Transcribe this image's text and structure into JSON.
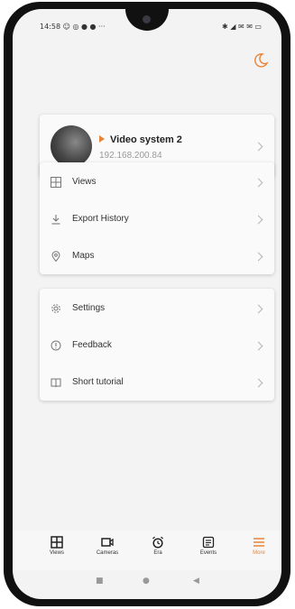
{
  "status_bar": {
    "time_and_icons": "14:58 ☺ ◎ ● ● ···",
    "right_icons": "✱ ◢ ✉ ✉ ▭"
  },
  "system": {
    "name": "Video system 2",
    "ip": "192.168.200.84"
  },
  "menu_group_1": [
    {
      "label": "Views",
      "icon": "grid-icon"
    },
    {
      "label": "Export History",
      "icon": "download-icon"
    },
    {
      "label": "Maps",
      "icon": "map-pin-icon"
    }
  ],
  "menu_group_2": [
    {
      "label": "Settings",
      "icon": "gear-icon"
    },
    {
      "label": "Feedback",
      "icon": "info-icon"
    },
    {
      "label": "Short tutorial",
      "icon": "book-icon"
    }
  ],
  "bottom_nav": [
    {
      "label": "Views",
      "icon": "views-icon",
      "active": false
    },
    {
      "label": "Cameras",
      "icon": "camera-icon",
      "active": false
    },
    {
      "label": "Era",
      "icon": "alarm-icon",
      "active": false
    },
    {
      "label": "Events",
      "icon": "events-icon",
      "active": false
    },
    {
      "label": "More",
      "icon": "menu-icon",
      "active": true
    }
  ],
  "colors": {
    "accent": "#e8843a",
    "background": "#f3f3f3",
    "card": "#fafafa"
  }
}
